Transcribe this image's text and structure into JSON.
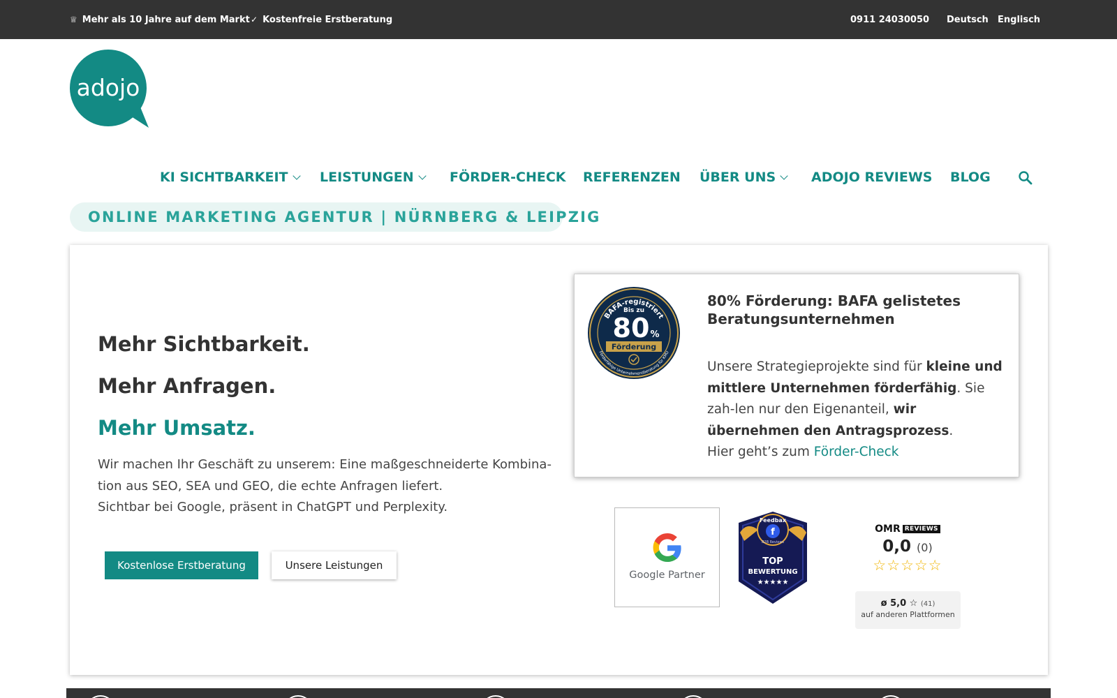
{
  "topbar": {
    "item1": "Mehr als 10 Jahre auf dem Markt",
    "item2": "Kostenfreie Erstberatung",
    "phone": "0911 24030050",
    "lang_de": "Deutsch",
    "lang_en": "Englisch"
  },
  "logo": {
    "text": "adojo",
    "color": "#138a84"
  },
  "nav": {
    "items": [
      {
        "label": "KI SICHTBARKEIT"
      },
      {
        "label": "LEISTUNGEN"
      },
      {
        "label": "FÖRDER-CHECK"
      },
      {
        "label": "REFERENZEN"
      },
      {
        "label": "ÜBER UNS"
      },
      {
        "label": "ADOJO REVIEWS"
      },
      {
        "label": "BLOG"
      }
    ],
    "search_icon": "search-icon"
  },
  "tagline": "ONLINE MARKETING AGENTUR | NÜRNBERG & LEIPZIG",
  "hero": {
    "line1": "Mehr Sichtbarkeit.",
    "line2": "Mehr Anfragen.",
    "line3": "Mehr Umsatz.",
    "text1": "Wir machen Ihr Geschäft zu unserem: Eine maßgeschneiderte Kombina-tion aus SEO, SEA und GEO, die echte Anfragen liefert.",
    "text2": "Sichtbar bei Google, präsent in ChatGPT und Perplexity.",
    "btn_primary": "Kostenlose Erstberatung",
    "btn_secondary": "Unsere Leistungen"
  },
  "bafa": {
    "title": "80% Förderung: BAFA gelistetes Beratungsunternehmen",
    "t1": "Unsere Strategieprojekte sind für ",
    "b1": "kleine und mittlere Unternehmen förderfähig",
    "t2": ". Sie zah-len nur den Eigenanteil, ",
    "b2": "wir übernehmen den Antragsprozess",
    "t3": ".",
    "t4": "Hier geht’s zum ",
    "link": "Förder-Check",
    "badge": {
      "top": "BAFA-registriert",
      "bis": "Bis zu",
      "num": "80",
      "pct": "%",
      "band": "Förderung",
      "ring": "Förderfähige Unternehmensberatung für KMU"
    }
  },
  "google": {
    "label": "Google Partner"
  },
  "feedbax": {
    "name": "Feedbax",
    "sub": "B2B Reviews",
    "line1": "TOP",
    "line2": "BEWERTUNG",
    "stars": "★★★★★"
  },
  "omr": {
    "logo": "OMR",
    "logo_tag": "REVIEWS",
    "score": "0,0",
    "count": "(0)",
    "stars": "☆☆☆☆☆",
    "avg": "ø 5,0",
    "avg_star": "☆",
    "avg_count": "(41)",
    "other": "auf anderen Plattformen"
  },
  "colors": {
    "accent": "#138a84",
    "topbar": "#333333",
    "tagline_bg": "#e8f5f3",
    "star": "#f0b400"
  }
}
